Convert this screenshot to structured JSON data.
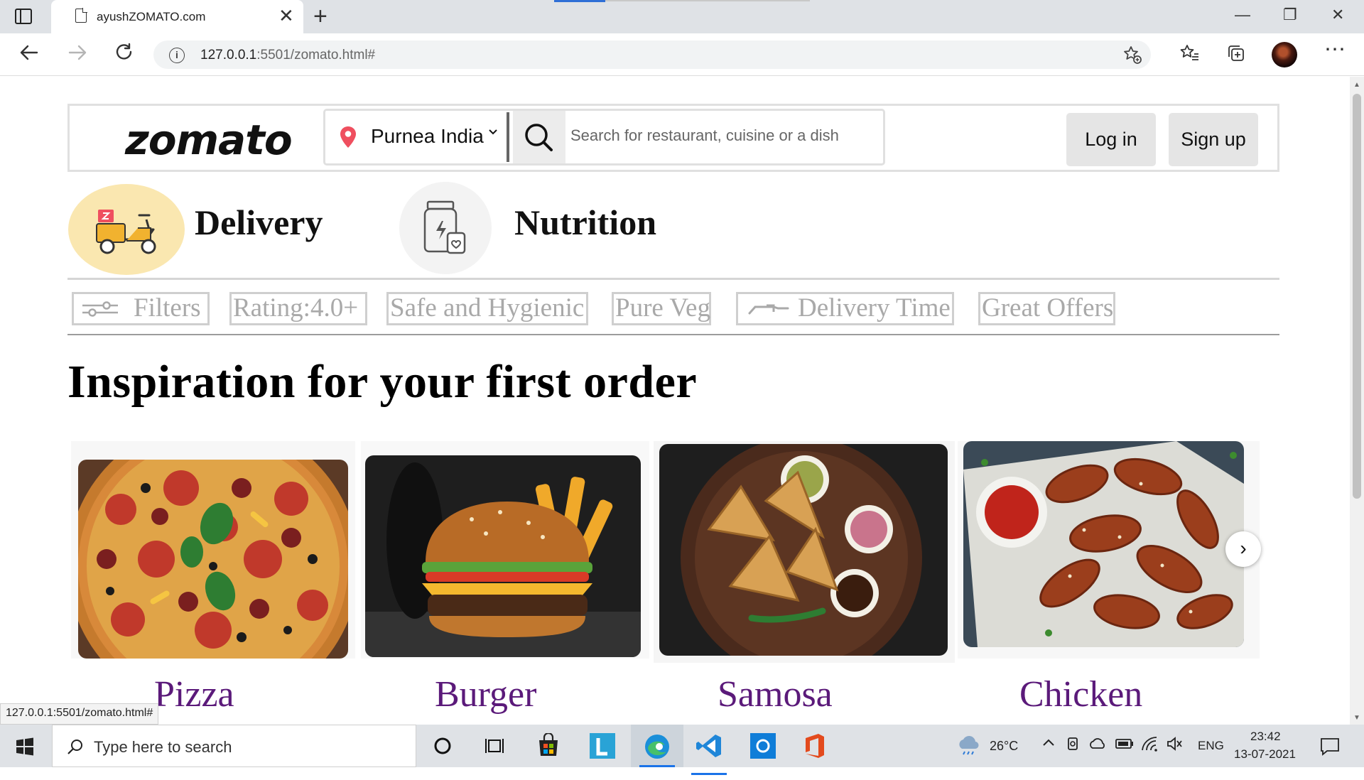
{
  "browser": {
    "tab_title": "ayushZOMATO.com",
    "tab_close": "✕",
    "new_tab": "+",
    "url_host": "127.0.0.1",
    "url_path": ":5501/zomato.html#",
    "window_controls": {
      "minimize": "—",
      "restore": "❐",
      "close": "✕"
    },
    "status_url": "127.0.0.1:5501/zomato.html#"
  },
  "navbar": {
    "logo": "zomato",
    "location": "Purnea India",
    "search_placeholder": "Search for restaurant, cuisine or a dish",
    "login_label": "Log in",
    "signup_label": "Sign up"
  },
  "modes": {
    "delivery": "Delivery",
    "nutrition": "Nutrition"
  },
  "filters": [
    {
      "label": "Filters",
      "icon": "sliders-icon"
    },
    {
      "label": "Rating:4.0+"
    },
    {
      "label": "Safe and Hygienic"
    },
    {
      "label": "Pure Veg"
    },
    {
      "label": "Delivery Time",
      "icon": "sort-icon"
    },
    {
      "label": "Great Offers"
    }
  ],
  "section": {
    "heading": "Inspiration for your first order"
  },
  "dishes": [
    {
      "label": "Pizza"
    },
    {
      "label": "Burger"
    },
    {
      "label": "Samosa"
    },
    {
      "label": "Chicken"
    }
  ],
  "carousel": {
    "next": "›"
  },
  "taskbar": {
    "search_placeholder": "Type here to search",
    "temperature": "26°C",
    "language": "ENG",
    "time": "23:42",
    "date": "13-07-2021"
  },
  "colors": {
    "dish_label": "#5b1a7a",
    "delivery_circle": "#fae7b0",
    "pin": "#ef4f5f",
    "edge_blue": "#1a73e8"
  }
}
